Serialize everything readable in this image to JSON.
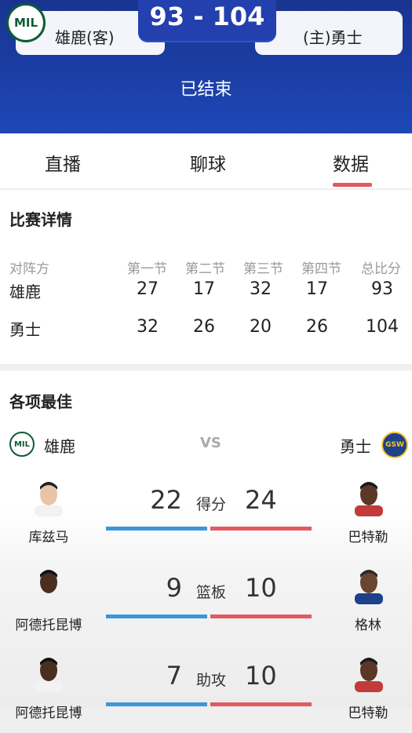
{
  "header": {
    "away_team": "雄鹿(客)",
    "home_team": "(主)勇士",
    "score": "93 - 104",
    "status": "已结束",
    "away_logo": "MIL"
  },
  "tabs": [
    "直播",
    "聊球",
    "数据"
  ],
  "game_detail": {
    "title": "比赛详情",
    "headers": [
      "对阵方",
      "第一节",
      "第二节",
      "第三节",
      "第四节",
      "总比分"
    ],
    "rows": [
      {
        "team": "雄鹿",
        "q1": "27",
        "q2": "17",
        "q3": "32",
        "q4": "17",
        "total": "93"
      },
      {
        "team": "勇士",
        "q1": "32",
        "q2": "26",
        "q3": "20",
        "q4": "26",
        "total": "104"
      }
    ]
  },
  "leaders": {
    "title": "各项最佳",
    "away_team": "雄鹿",
    "home_team": "勇士",
    "away_logo": "MIL",
    "home_logo": "GSW",
    "vs": "VS",
    "stats": [
      {
        "label": "得分",
        "away_value": "22",
        "home_value": "24",
        "away_player": "库兹马",
        "home_player": "巴特勒"
      },
      {
        "label": "篮板",
        "away_value": "9",
        "home_value": "10",
        "away_player": "阿德托昆博",
        "home_player": "格林"
      },
      {
        "label": "助攻",
        "away_value": "7",
        "home_value": "10",
        "away_player": "阿德托昆博",
        "home_player": "巴特勒"
      }
    ]
  },
  "colors": {
    "header_blue": "#1c3fa7",
    "away_bar": "#3c97d9",
    "home_bar": "#e15b60",
    "tab_underline": "#e15b60"
  }
}
